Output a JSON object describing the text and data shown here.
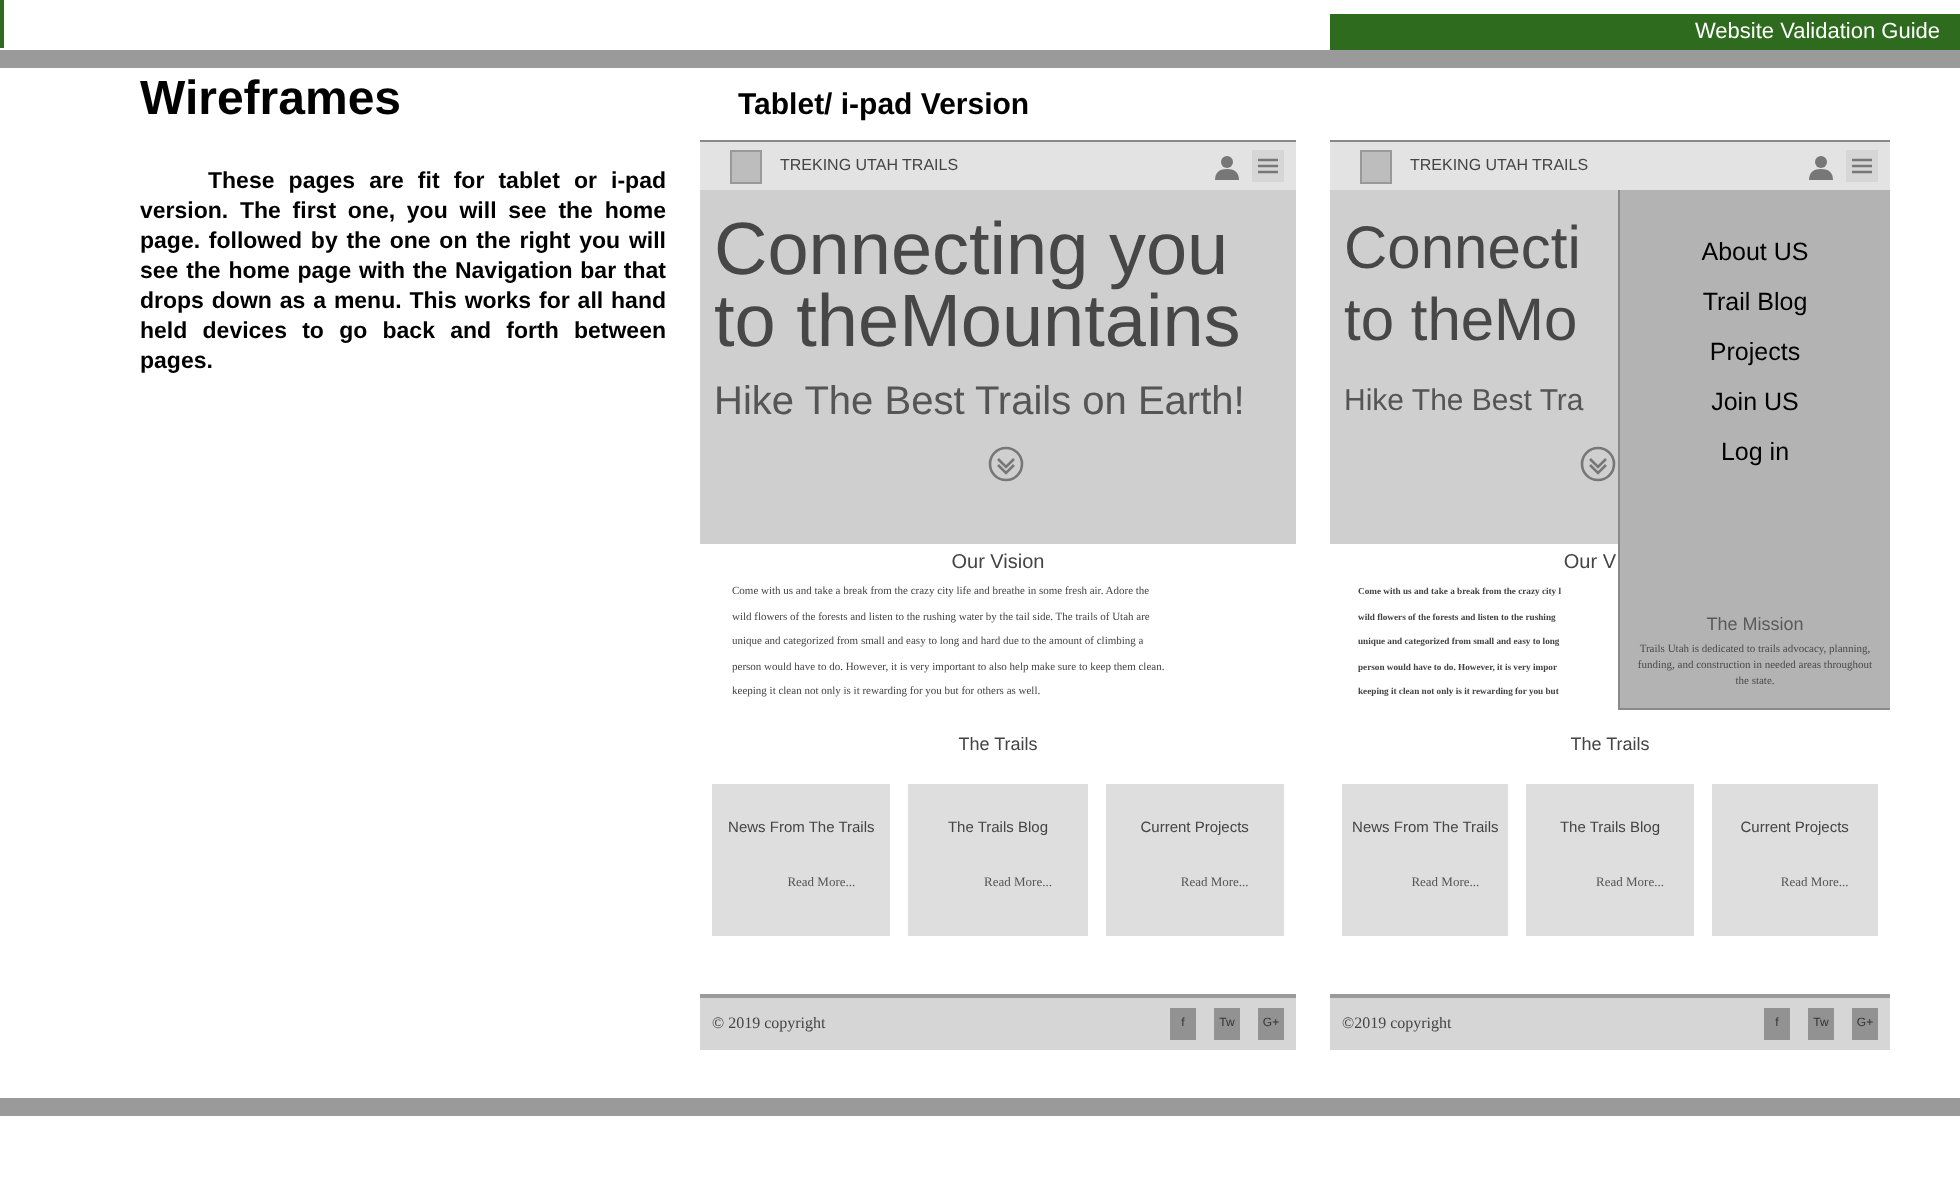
{
  "header": {
    "title": "Website Validation Guide"
  },
  "section": {
    "title": "Wireframes",
    "body": "These pages are fit for tablet or i-pad version.  The first one, you will see the home page. followed by the one on the right you will see the home page with the Navigation bar that drops down as a menu.  This works for all hand held devices to go back and forth between pages."
  },
  "wireframes": {
    "caption": "Tablet/ i-pad Version",
    "screens": [
      {
        "brand": "TREKING UTAH TRAILS",
        "hero_lines": [
          "Connecting you",
          "to theMountains"
        ],
        "hero_subtitle": "Hike The Best Trails on Earth!",
        "vision_title": "Our Vision",
        "vision_lines": [
          "Come with us and take a break from the crazy city life and breathe in some fresh air.  Adore the",
          "wild flowers of the forests and listen to the rushing water by the tail side. The trails of Utah are",
          "unique and categorized from small and easy to long and hard due to the amount of climbing a",
          "person would have to do.  However, it is very important to also help make sure to keep them clean.",
          "keeping it clean not only is it rewarding for you but for others as well."
        ],
        "trails_title": "The Trails",
        "cards": [
          {
            "title": "News From The Trails",
            "link": "Read More..."
          },
          {
            "title": "The Trails Blog",
            "link": "Read More..."
          },
          {
            "title": "Current Projects",
            "link": "Read More..."
          }
        ],
        "copyright": "© 2019 copyright",
        "social": [
          "f",
          "Tw",
          "G+"
        ]
      },
      {
        "brand": "TREKING UTAH TRAILS",
        "hero_lines": [
          "Connecti",
          "to theMo"
        ],
        "hero_subtitle": "Hike The Best Tra",
        "vision_title": "Our V",
        "vision_lines": [
          "Come with us and take a break from the crazy city l",
          "wild flowers of the forests and listen to the rushing",
          "unique and categorized from small and easy to long",
          "person would have to do.  However, it is very impor",
          "keeping it clean not only is it rewarding for you but"
        ],
        "trails_title": "The Trails",
        "cards": [
          {
            "title": "News From The Trails",
            "link": "Read More..."
          },
          {
            "title": "The Trails Blog",
            "link": "Read More..."
          },
          {
            "title": "Current Projects",
            "link": "Read More..."
          }
        ],
        "copyright": "©2019 copyright",
        "social": [
          "f",
          "Tw",
          "G+"
        ],
        "menu": {
          "items": [
            "About US",
            "Trail Blog",
            "Projects",
            "Join US",
            "Log in"
          ],
          "mission_title": "The Mission",
          "mission_text": "Trails Utah is dedicated to trails advocacy, planning, funding, and construction in needed areas throughout the state."
        }
      }
    ]
  }
}
